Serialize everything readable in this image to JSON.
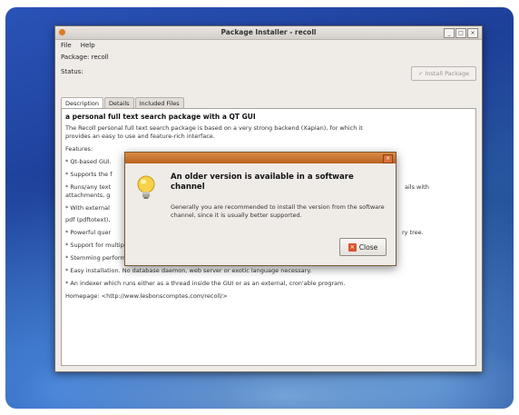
{
  "window": {
    "title": "Package Installer - recoll",
    "menu": [
      "File",
      "Help"
    ],
    "package_label": "Package:",
    "package_value": "recoll",
    "status_label": "Status:",
    "install_button": "Install Package",
    "controls": [
      "_",
      "□",
      "×"
    ]
  },
  "tabs": [
    "Description",
    "Details",
    "Included Files"
  ],
  "description": {
    "heading": "a personal full text search package with a QT GUI",
    "lines": [
      "The Recoll personal full text search package is based on a very strong backend (Xapian), for which it",
      "provides an easy to use and feature-rich interface.",
      "Features:",
      "* Qt-based GUI.",
      "* Supports the f",
      "* Runs/any text",
      "attachments, g",
      "* With external",
      "pdf (pdftotext),",
      "* Powerful quer",
      "* Support for multiple character sets, internal processing and storage uses Unicode UTF-8.",
      "* Stemming performed at query time (can switch stemming language after indexing).",
      "* Easy installation. No database daemon, web server or exotic language necessary.",
      "* An indexer which runs either as a thread inside the GUI or as an external, cron'able program.",
      "Homepage: <http://www.lesbonscomptes.com/recoll/>"
    ],
    "right_fragments": [
      "ails with",
      "ry tree."
    ]
  },
  "dialog": {
    "heading": "An older version is available in a software channel",
    "body": "Generally you are recommended to install the version from the software channel, since it is usually better supported.",
    "close_label": "Close"
  }
}
